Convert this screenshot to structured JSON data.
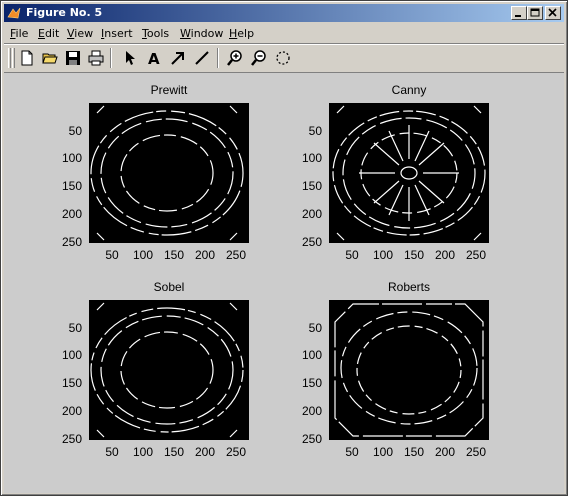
{
  "window": {
    "title": "Figure No. 5"
  },
  "menu": [
    {
      "underline": "F",
      "rest": "ile"
    },
    {
      "underline": "E",
      "rest": "dit"
    },
    {
      "underline": "V",
      "rest": "iew"
    },
    {
      "underline": "I",
      "rest": "nsert"
    },
    {
      "underline": "T",
      "rest": "ools"
    },
    {
      "underline": "W",
      "rest": "indow"
    },
    {
      "underline": "H",
      "rest": "elp"
    }
  ],
  "toolbar": {
    "icons": [
      "new-file-icon",
      "open-folder-icon",
      "save-icon",
      "print-icon",
      "pointer-icon",
      "text-icon",
      "arrow-icon",
      "line-icon",
      "zoom-in-icon",
      "zoom-out-icon",
      "rotate-icon"
    ]
  },
  "subplots": [
    {
      "title": "Prewitt"
    },
    {
      "title": "Canny"
    },
    {
      "title": "Sobel"
    },
    {
      "title": "Roberts"
    }
  ],
  "axes": {
    "yticks": [
      "50",
      "100",
      "150",
      "200",
      "250"
    ],
    "xticks": [
      "50",
      "100",
      "150",
      "200",
      "250"
    ]
  }
}
